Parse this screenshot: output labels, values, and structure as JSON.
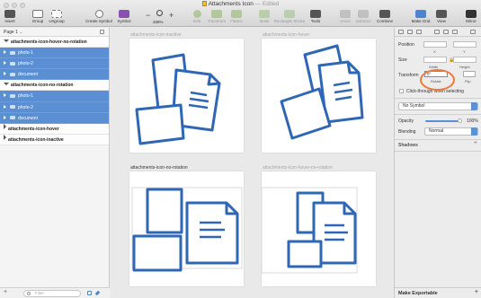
{
  "window": {
    "title": "Attachments Icon",
    "title_suffix": "— Edited"
  },
  "toolbar": {
    "insert": "Insert",
    "group": "Group",
    "ungroup": "Ungroup",
    "create_symbol": "Create Symbol",
    "symbol": "Symbol",
    "zoom_level": "488%",
    "edit": "Edit",
    "transform": "Transform",
    "rotate": "Rotate",
    "flatten": "Flatten",
    "mask": "Mask",
    "scale": "Scale",
    "union": "Union",
    "subtract": "Subtract",
    "intersect": "Intersect",
    "difference": "Difference",
    "forward": "Forward",
    "backward": "Backward",
    "make_grid": "Make Grid",
    "view": "View",
    "mirror": "Mirror",
    "tools": "Tools",
    "combine": "Combine",
    "rectangle_stroke": "Rectangle Stroke"
  },
  "left_panel": {
    "page": "Page 1",
    "layers": [
      {
        "label": "attachments-icon-hover-no-rotation",
        "type": "artboard",
        "expanded": true
      },
      {
        "label": "photo-1",
        "type": "group",
        "selected": true
      },
      {
        "label": "photo-2",
        "type": "group",
        "selected": true
      },
      {
        "label": "document",
        "type": "group",
        "selected": true
      },
      {
        "label": "attachments-icon-no-rotation",
        "type": "artboard",
        "expanded": true
      },
      {
        "label": "photo-1",
        "type": "group",
        "selected": true
      },
      {
        "label": "photo-2",
        "type": "group",
        "selected": true
      },
      {
        "label": "document",
        "type": "group",
        "selected": true
      },
      {
        "label": "attachments-icon-hover",
        "type": "artboard",
        "expanded": false
      },
      {
        "label": "attachments-icon-inactive",
        "type": "artboard",
        "expanded": false
      }
    ],
    "filter_placeholder": "Filter"
  },
  "canvas": {
    "artboards": [
      {
        "label": "attachments-icon-inactive",
        "active": false
      },
      {
        "label": "attachments-icon-hover",
        "active": false
      },
      {
        "label": "attachments-icon-no-rotation",
        "active": true
      },
      {
        "label": "attachments-icon-hover-no-rotation",
        "active": false
      }
    ],
    "icon_color": "#2f67b5"
  },
  "inspector": {
    "position": "Position",
    "x": "X",
    "y": "Y",
    "size": "Size",
    "width": "Width",
    "height": "Height",
    "transform": "Transform",
    "rotation_value": "0°",
    "rotate": "Rotate",
    "flip": "Flip",
    "click_through": "Click-through when selecting",
    "symbol": "No Symbol",
    "opacity": "Opacity",
    "opacity_value": "100%",
    "blending": "Blending",
    "blending_value": "Normal",
    "shadows": "Shadows",
    "make_exportable": "Make Exportable"
  }
}
